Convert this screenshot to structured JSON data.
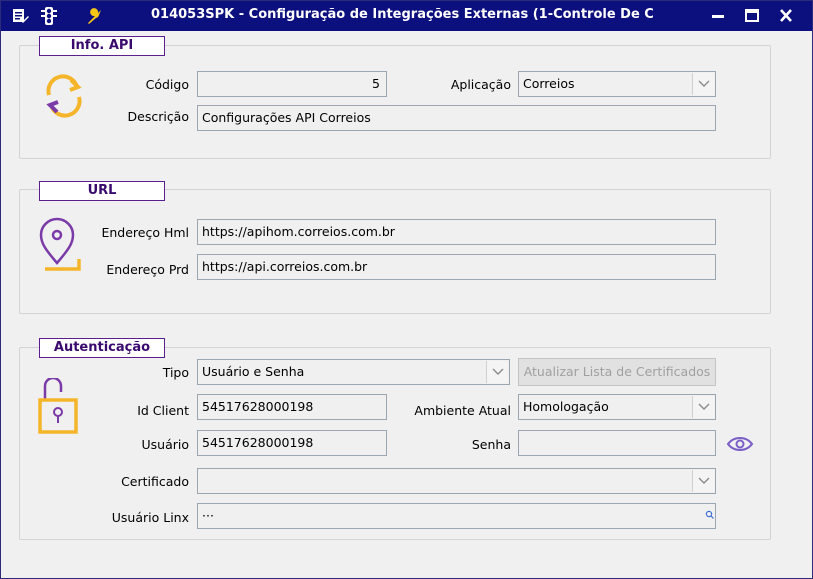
{
  "window": {
    "title": "014053SPK - Configuração de Integrações Externas (1-Controle De C",
    "icons": [
      "edit-icon",
      "traffic-light-icon",
      "wrench-icon"
    ],
    "controls": [
      "minimize-icon",
      "maximize-icon",
      "close-icon"
    ]
  },
  "info_api": {
    "heading": "Info. API",
    "icon": "refresh-icon",
    "codigo_label": "Código",
    "codigo_value": "5",
    "aplicacao_label": "Aplicação",
    "aplicacao_value": "Correios",
    "descricao_label": "Descrição",
    "descricao_value": "Configurações API Correios"
  },
  "url": {
    "heading": "URL",
    "icon": "map-pin-icon",
    "hml_label": "Endereço Hml",
    "hml_value": "https://apihom.correios.com.br",
    "prd_label": "Endereço Prd",
    "prd_value": "https://api.correios.com.br"
  },
  "auth": {
    "heading": "Autenticação",
    "icon": "padlock-icon",
    "tipo_label": "Tipo",
    "tipo_value": "Usuário e Senha",
    "refresh_button": "Atualizar Lista de Certificados",
    "client_label": "Id Client",
    "client_value": "54517628000198",
    "ambiente_label": "Ambiente Atual",
    "ambiente_value": "Homologação",
    "usuario_label": "Usuário",
    "usuario_value": "54517628000198",
    "senha_label": "Senha",
    "senha_value": "",
    "certificado_label": "Certificado",
    "certificado_value": "",
    "linx_label": "Usuário Linx",
    "linx_value": "···"
  },
  "colors": {
    "titlebar": "#0c0f7e",
    "group_heading_border": "#5a1f8c",
    "icon_orange": "#f5b52a",
    "icon_purple": "#7a3aa8",
    "eye_purple": "#7a5fc7"
  }
}
